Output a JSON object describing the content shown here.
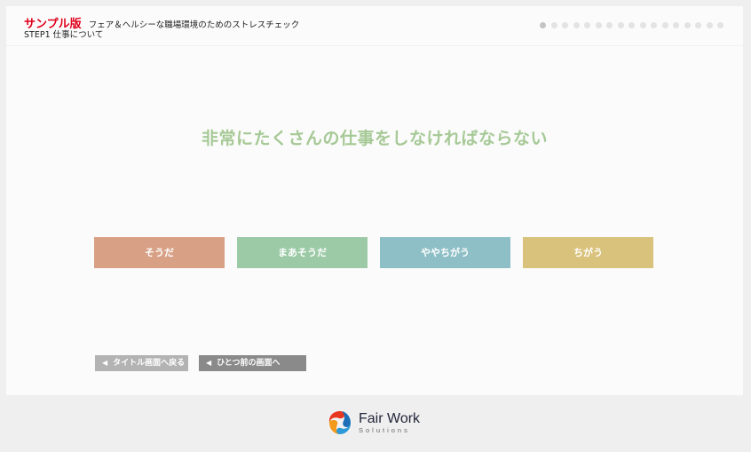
{
  "header": {
    "sample_label": "サンプル版",
    "subtitle": "フェア＆ヘルシーな職場環境のためのストレスチェック",
    "step": "STEP1 仕事について"
  },
  "progress": {
    "total": 17,
    "current": 1
  },
  "question": {
    "text": "非常にたくさんの仕事をしなければならない"
  },
  "answers": [
    {
      "label": "そうだ",
      "color": "#d8a186"
    },
    {
      "label": "まあそうだ",
      "color": "#9ccaa7"
    },
    {
      "label": "ややちがう",
      "color": "#8ebfc6"
    },
    {
      "label": "ちがう",
      "color": "#d9c27b"
    }
  ],
  "nav": {
    "back_title": "タイトル画面へ戻る",
    "back_prev": "ひとつ前の画面へ"
  },
  "footer": {
    "logo_name": "Fair Work",
    "logo_sub": "Solutions",
    "logo_icon": "fair-work-logo-icon"
  }
}
